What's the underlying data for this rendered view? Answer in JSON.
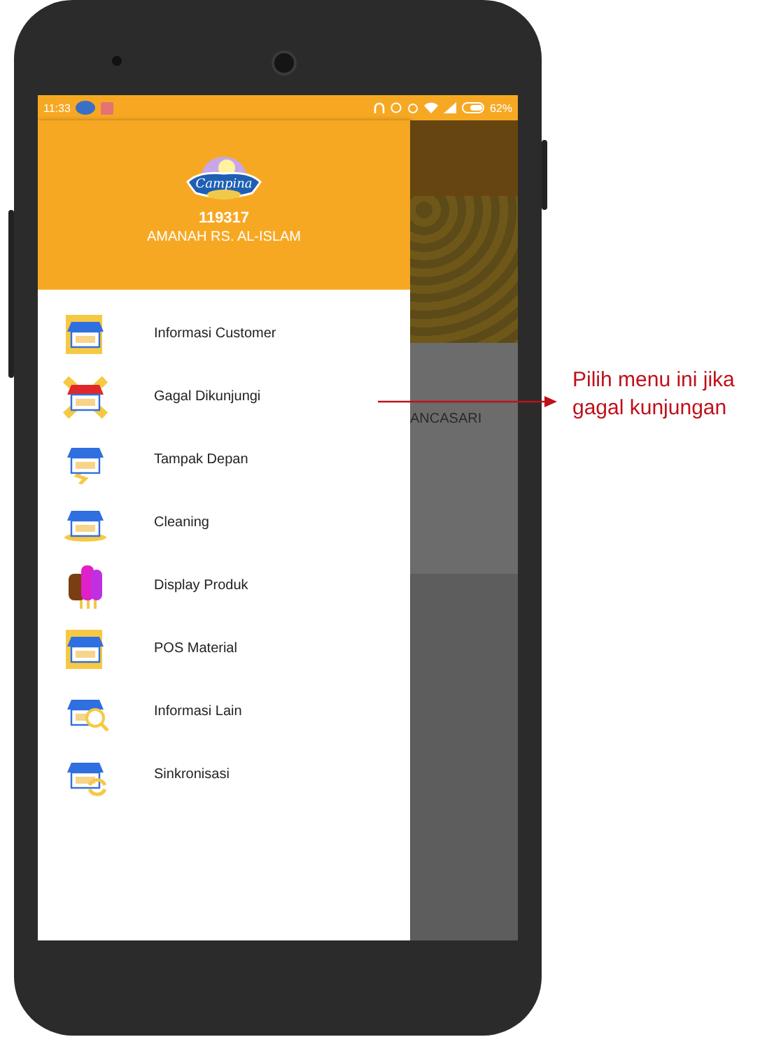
{
  "status_bar": {
    "time": "11:33",
    "battery": "62%"
  },
  "drawer": {
    "logo_text": "Campina",
    "customer_id": "119317",
    "customer_name": "AMANAH RS. AL-ISLAM",
    "items": [
      {
        "label": "Informasi Customer"
      },
      {
        "label": "Gagal Dikunjungi"
      },
      {
        "label": "Tampak Depan"
      },
      {
        "label": "Cleaning"
      },
      {
        "label": "Display Produk"
      },
      {
        "label": "POS Material"
      },
      {
        "label": "Informasi Lain"
      },
      {
        "label": "Sinkronisasi"
      }
    ]
  },
  "background_screen": {
    "text": "ANCASARI"
  },
  "annotation": {
    "text": "Pilih menu ini jika gagal kunjungan"
  }
}
